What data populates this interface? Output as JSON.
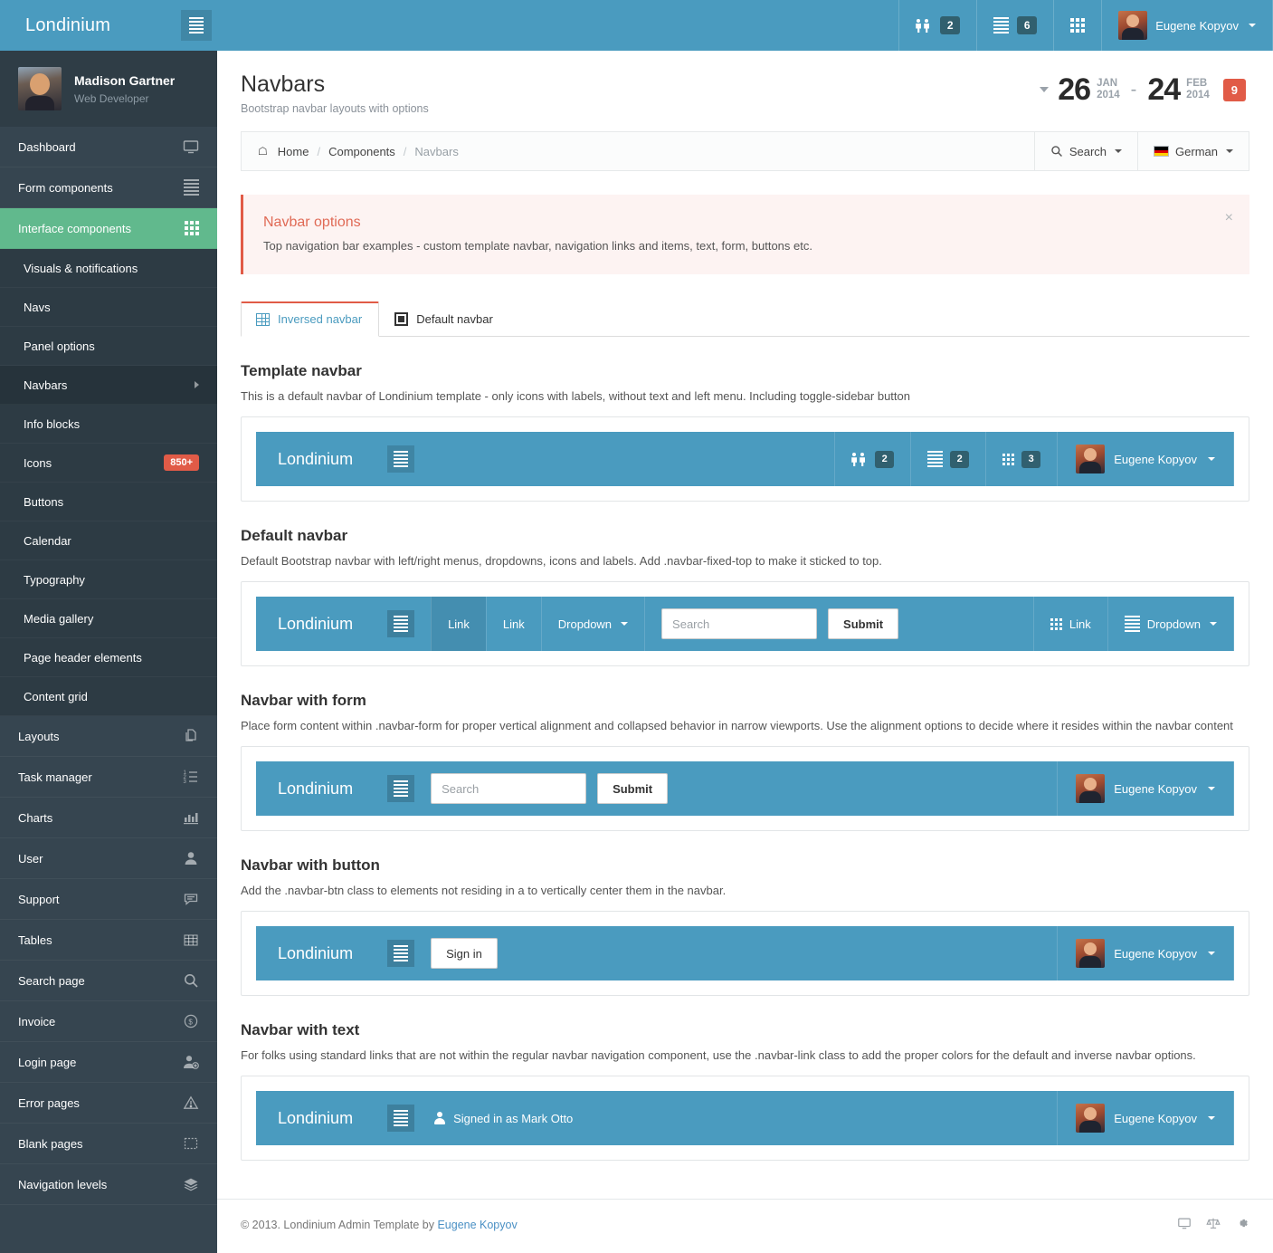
{
  "app": {
    "brand": "Londinium",
    "toggle_icon": "hamburger-icon"
  },
  "topbar": {
    "items": [
      {
        "icon": "people-icon",
        "badge": "2"
      },
      {
        "icon": "lines-icon",
        "badge": "6"
      },
      {
        "icon": "grid-icon",
        "badge": ""
      }
    ],
    "user": "Eugene Kopyov"
  },
  "sidebar": {
    "profile": {
      "name": "Madison Gartner",
      "role": "Web Developer"
    },
    "items": [
      {
        "label": "Dashboard",
        "icon": "monitor-icon",
        "state": "normal"
      },
      {
        "label": "Form components",
        "icon": "lines-icon",
        "state": "normal"
      },
      {
        "label": "Interface components",
        "icon": "grid-icon",
        "state": "active"
      }
    ],
    "sub_items": [
      {
        "label": "Visuals & notifications"
      },
      {
        "label": "Navs"
      },
      {
        "label": "Panel options"
      },
      {
        "label": "Navbars",
        "state": "current",
        "chevron": "chevron-right-icon"
      },
      {
        "label": "Info blocks"
      },
      {
        "label": "Icons",
        "badge": "850+"
      },
      {
        "label": "Buttons"
      },
      {
        "label": "Calendar"
      },
      {
        "label": "Typography"
      },
      {
        "label": "Media gallery"
      },
      {
        "label": "Page header elements"
      },
      {
        "label": "Content grid"
      }
    ],
    "items_after": [
      {
        "label": "Layouts",
        "icon": "pages-icon"
      },
      {
        "label": "Task manager",
        "icon": "ordered-list-icon"
      },
      {
        "label": "Charts",
        "icon": "bar-chart-icon"
      },
      {
        "label": "User",
        "icon": "user-icon"
      },
      {
        "label": "Support",
        "icon": "chat-icon"
      },
      {
        "label": "Tables",
        "icon": "table-icon"
      },
      {
        "label": "Search page",
        "icon": "search-icon"
      },
      {
        "label": "Invoice",
        "icon": "dollar-circle-icon"
      },
      {
        "label": "Login page",
        "icon": "user-add-icon"
      },
      {
        "label": "Error pages",
        "icon": "warning-icon"
      },
      {
        "label": "Blank pages",
        "icon": "blank-page-icon"
      },
      {
        "label": "Navigation levels",
        "icon": "layers-icon"
      }
    ]
  },
  "page": {
    "title": "Navbars",
    "subtitle": "Bootstrap navbar layouts with options"
  },
  "daterange": {
    "start_day": "26",
    "start_month": "JAN",
    "start_year": "2014",
    "dash": "-",
    "end_day": "24",
    "end_month": "FEB",
    "end_year": "2014",
    "badge": "9"
  },
  "breadcrumb": {
    "home": "Home",
    "sep": "/",
    "components": "Components",
    "current": "Navbars"
  },
  "toolbar": {
    "search_label": "Search",
    "language_label": "German"
  },
  "alert": {
    "title": "Navbar options",
    "text": "Top navigation bar examples - custom template navbar, navigation links and items, text, form, buttons etc.",
    "close": "×"
  },
  "tabs": [
    {
      "label": "Inversed navbar",
      "icon": "table-grid-icon",
      "active": true
    },
    {
      "label": "Default navbar",
      "icon": "filled-square-icon",
      "active": false
    }
  ],
  "sections": [
    {
      "title": "Template navbar",
      "desc": "This is a default navbar of Londinium template - only icons with labels, without text and left menu. Including toggle-sidebar button"
    },
    {
      "title": "Default navbar",
      "desc": "Default Bootstrap navbar with left/right menus, dropdowns, icons and labels. Add .navbar-fixed-top to make it sticked to top."
    },
    {
      "title": "Navbar with form",
      "desc": "Place form content within .navbar-form for proper vertical alignment and collapsed behavior in narrow viewports. Use the alignment options to decide where it resides within the navbar content"
    },
    {
      "title": "Navbar with button",
      "desc": "Add the .navbar-btn class to elements not residing in a to vertically center them in the navbar."
    },
    {
      "title": "Navbar with text",
      "desc": "For folks using standard links that are not within the regular navbar navigation component, use the .navbar-link class to add the proper colors for the default and inverse navbar options."
    }
  ],
  "demo1": {
    "brand": "Londinium",
    "badges": [
      "2",
      "2",
      "3"
    ],
    "user": "Eugene Kopyov"
  },
  "demo2": {
    "brand": "Londinium",
    "link1": "Link",
    "link2": "Link",
    "dropdown": "Dropdown",
    "search_placeholder": "Search",
    "submit": "Submit",
    "right_link": "Link",
    "right_dropdown": "Dropdown"
  },
  "demo3": {
    "brand": "Londinium",
    "search_placeholder": "Search",
    "submit": "Submit",
    "user": "Eugene Kopyov"
  },
  "demo4": {
    "brand": "Londinium",
    "button": "Sign in",
    "user": "Eugene Kopyov"
  },
  "demo5": {
    "brand": "Londinium",
    "text": "Signed in as Mark Otto",
    "user": "Eugene Kopyov"
  },
  "footer": {
    "copyright_prefix": "© 2013. Londinium Admin Template by ",
    "author": "Eugene Kopyov",
    "icons": [
      "monitor-icon",
      "scales-icon",
      "gear-icon"
    ]
  },
  "colors": {
    "brand_blue": "#4A9BBF",
    "sidebar": "#364550",
    "accent_green": "#61b98d",
    "accent_red": "#e15b47"
  }
}
